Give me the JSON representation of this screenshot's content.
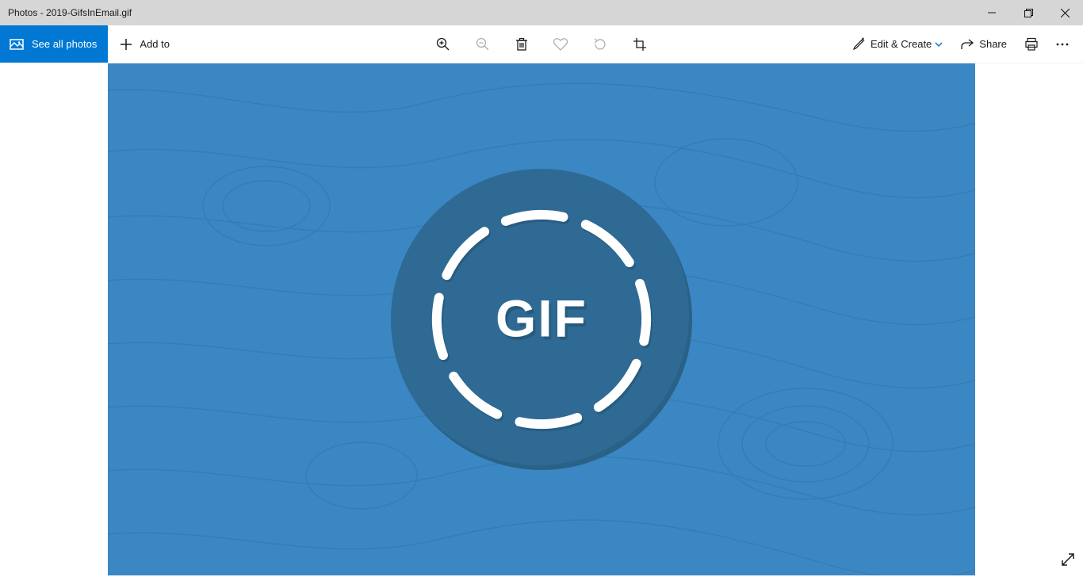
{
  "window": {
    "title": "Photos - 2019-GifsInEmail.gif"
  },
  "toolbar": {
    "see_all_label": "See all photos",
    "add_to_label": "Add to",
    "edit_create_label": "Edit & Create",
    "share_label": "Share"
  },
  "image": {
    "badge_text": "GIF",
    "bg_color": "#3a87c3",
    "circle_color": "#2e6a93"
  },
  "icons": {
    "zoom_in": "zoom-in-icon",
    "zoom_out": "zoom-out-icon",
    "delete": "trash-icon",
    "favorite": "heart-icon",
    "rotate": "rotate-icon",
    "crop": "crop-icon",
    "edit": "edit-create-icon",
    "share": "share-icon",
    "print": "print-icon",
    "more": "more-icon"
  }
}
